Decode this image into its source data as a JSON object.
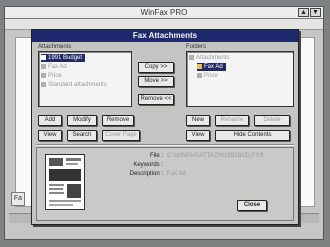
{
  "app": {
    "title": "WinFax PRO",
    "scroll_up": "▲",
    "scroll_dn": "▼",
    "left_tab": "Fa"
  },
  "dialog": {
    "title": "Fax Attachments",
    "attachments_label": "Attachments",
    "folders_label": "Folders",
    "attachments": [
      {
        "label": "1991 Budget",
        "selected": true
      },
      {
        "label": "Fax Ad",
        "selected": false
      },
      {
        "label": "Price",
        "selected": false
      },
      {
        "label": "Standard attachments",
        "selected": false
      }
    ],
    "folders": [
      {
        "label": "Attachments",
        "selected": false
      },
      {
        "label": "Fax Ad",
        "selected": true
      },
      {
        "label": "Price",
        "selected": false
      }
    ],
    "buttons": {
      "copy": "Copy >>",
      "move": "Move >>",
      "remove_mid": "Remove <<",
      "add": "Add",
      "modify": "Modify",
      "remove": "Remove",
      "view_left": "View",
      "search": "Search",
      "cover_page": "Cover Page",
      "new": "New",
      "rename": "Rename",
      "delete": "Delete",
      "view_right": "View",
      "hide_contents": "Hide Contents",
      "close": "Close"
    },
    "details": {
      "file_label": "File :",
      "file_value": "C:\\WINFAX\\ATTACH\\1991BUD.FXS",
      "keywords_label": "Keywords :",
      "keywords_value": "",
      "description_label": "Description :",
      "description_value": "Fax Ad"
    }
  }
}
